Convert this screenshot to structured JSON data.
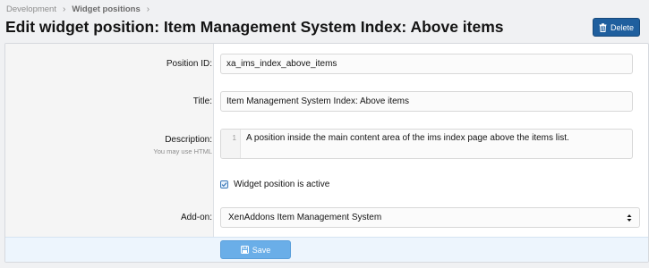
{
  "breadcrumb": {
    "items": [
      "Development",
      "Widget positions"
    ],
    "separator": "›"
  },
  "header": {
    "title": "Edit widget position: Item Management System Index: Above items",
    "delete_label": "Delete"
  },
  "form": {
    "position_id": {
      "label": "Position ID:",
      "value": "xa_ims_index_above_items"
    },
    "title": {
      "label": "Title:",
      "value": "Item Management System Index: Above items"
    },
    "description": {
      "label": "Description:",
      "hint": "You may use HTML",
      "line_number": "1",
      "value": "A position inside the main content area of the ims index page above the items list."
    },
    "active": {
      "label": "Widget position is active",
      "checked": true
    },
    "addon": {
      "label": "Add-on:",
      "selected": "XenAddons Item Management System"
    },
    "save_label": "Save"
  },
  "icons": {
    "delete": "trash-icon",
    "active": "checkbox-check-icon",
    "select": "select-arrows-icon",
    "save": "save-icon"
  },
  "colors": {
    "primary": "#1f5f9e",
    "save_button": "#6aaee8",
    "checkbox": "#3a78b8"
  }
}
